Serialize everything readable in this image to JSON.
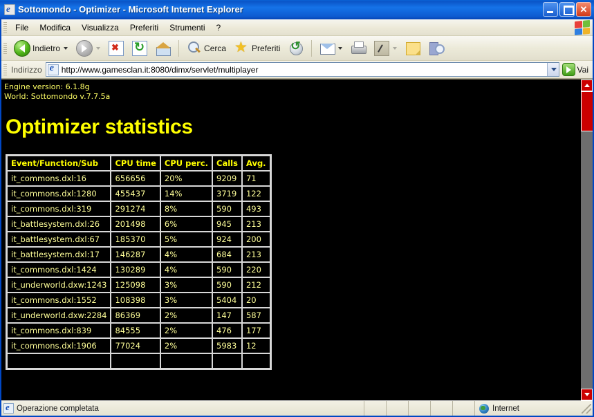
{
  "window": {
    "title": "Sottomondo - Optimizer - Microsoft Internet Explorer",
    "app_icon": "ie-document-icon",
    "minimize_label": "",
    "maximize_label": "",
    "close_label": "✕"
  },
  "menubar": {
    "items": [
      {
        "label": "File",
        "name": "menu-file"
      },
      {
        "label": "Modifica",
        "name": "menu-modifica"
      },
      {
        "label": "Visualizza",
        "name": "menu-visualizza"
      },
      {
        "label": "Preferiti",
        "name": "menu-preferiti"
      },
      {
        "label": "Strumenti",
        "name": "menu-strumenti"
      },
      {
        "label": "?",
        "name": "menu-help"
      }
    ],
    "brand_icon": "windows-flag-icon"
  },
  "toolbar": {
    "back_label": "Indietro",
    "forward_label": "",
    "stop_label": "",
    "refresh_label": "",
    "home_label": "",
    "search_label": "Cerca",
    "favorites_label": "Preferiti",
    "history_label": "",
    "mail_label": "",
    "print_label": "",
    "edit_label": "",
    "messenger_label": "",
    "discuss_label": ""
  },
  "address": {
    "label": "Indirizzo",
    "url": "http://www.gamesclan.it:8080/dimx/servlet/multiplayer",
    "placeholder": "",
    "go_label": "Vai"
  },
  "page": {
    "engine_version_line": "Engine version: 6.1.8g",
    "world_line": "World: Sottomondo v.7.7.5a",
    "title": "Optimizer statistics",
    "text_color": "#ffff00",
    "background_color": "#000000",
    "table": {
      "headers": [
        "Event/Function/Sub",
        "CPU time",
        "CPU perc.",
        "Calls",
        "Avg."
      ],
      "rows": [
        [
          "it_commons.dxl:16",
          "656656",
          "20%",
          "9209",
          "71"
        ],
        [
          "it_commons.dxl:1280",
          "455437",
          "14%",
          "3719",
          "122"
        ],
        [
          "it_commons.dxl:319",
          "291274",
          "8%",
          "590",
          "493"
        ],
        [
          "it_battlesystem.dxl:26",
          "201498",
          "6%",
          "945",
          "213"
        ],
        [
          "it_battlesystem.dxl:67",
          "185370",
          "5%",
          "924",
          "200"
        ],
        [
          "it_battlesystem.dxl:17",
          "146287",
          "4%",
          "684",
          "213"
        ],
        [
          "it_commons.dxl:1424",
          "130289",
          "4%",
          "590",
          "220"
        ],
        [
          "it_underworld.dxw:1243",
          "125098",
          "3%",
          "590",
          "212"
        ],
        [
          "it_commons.dxl:1552",
          "108398",
          "3%",
          "5404",
          "20"
        ],
        [
          "it_underworld.dxw:2284",
          "86369",
          "2%",
          "147",
          "587"
        ],
        [
          "it_commons.dxl:839",
          "84555",
          "2%",
          "476",
          "177"
        ],
        [
          "it_commons.dxl:1906",
          "77024",
          "2%",
          "5983",
          "12"
        ],
        [
          "",
          "",
          "",
          "",
          ""
        ]
      ]
    }
  },
  "scrollbar": {
    "accent_color": "#cc0000",
    "track_color": "#6e6e6e",
    "up_label": "",
    "down_label": ""
  },
  "statusbar": {
    "message": "Operazione completata",
    "zone": "Internet",
    "zone_icon": "globe-icon"
  }
}
